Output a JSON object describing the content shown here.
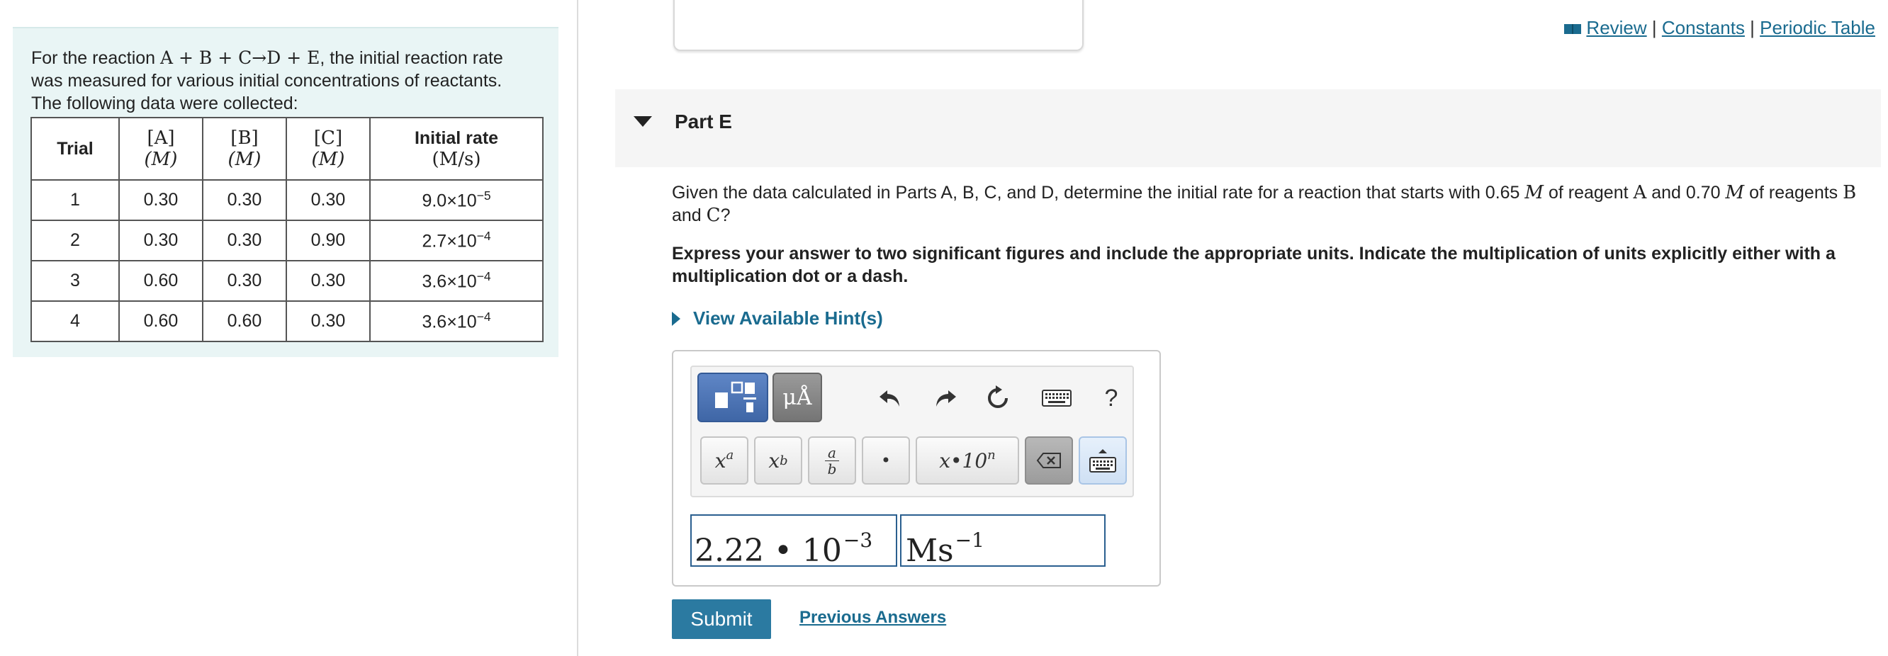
{
  "problem": {
    "intro_prefix": "For the reaction ",
    "reaction": "A + B + C→D + E",
    "intro_line1_suffix": ", the initial reaction rate",
    "intro_line2": "was measured for various initial concentrations of reactants.",
    "intro_line3": "The following data were collected:",
    "table": {
      "headers": {
        "trial": "Trial",
        "a_top": "[A]",
        "a_unit": "(M)",
        "b_top": "[B]",
        "b_unit": "(M)",
        "c_top": "[C]",
        "c_unit": "(M)",
        "rate_top": "Initial rate",
        "rate_unit": "(M/s)"
      },
      "rows": [
        {
          "trial": "1",
          "a": "0.30",
          "b": "0.30",
          "c": "0.30",
          "rate_base": "9.0×10",
          "rate_exp": "−5"
        },
        {
          "trial": "2",
          "a": "0.30",
          "b": "0.30",
          "c": "0.90",
          "rate_base": "2.7×10",
          "rate_exp": "−4"
        },
        {
          "trial": "3",
          "a": "0.60",
          "b": "0.30",
          "c": "0.30",
          "rate_base": "3.6×10",
          "rate_exp": "−4"
        },
        {
          "trial": "4",
          "a": "0.60",
          "b": "0.60",
          "c": "0.30",
          "rate_base": "3.6×10",
          "rate_exp": "−4"
        }
      ]
    }
  },
  "top_links": {
    "review": "Review",
    "sep1": " | ",
    "constants": "Constants",
    "sep2": " | ",
    "periodic_table": "Periodic Table"
  },
  "part": {
    "title": "Part E",
    "q_prefix": "Given the data calculated in Parts A, B, C, and D, determine the initial rate for a reaction that starts with 0.65 ",
    "q_unit1": "M",
    "q_mid1": " of reagent ",
    "q_reagent_a": "A",
    "q_mid2": " and 0.70 ",
    "q_unit2": "M",
    "q_mid3": " of reagents ",
    "q_reagent_b": "B",
    "q_mid4": " and ",
    "q_reagent_c": "C",
    "q_suffix": "?",
    "instructions": "Express your answer to two significant figures and include the appropriate units. Indicate the multiplication of units explicitly either with a multiplication dot or a dash.",
    "hint_label": "View Available Hint(s)"
  },
  "toolbar": {
    "units_label": "μÅ",
    "help_label": "?",
    "sup_base": "x",
    "sup_exp": "a",
    "sub_base": "x",
    "sub_sub": "b",
    "frac_num": "a",
    "frac_den": "b",
    "dot_label": "•",
    "sci_label": "x•10",
    "sci_exp": "n"
  },
  "answer": {
    "value_base": "2.22 • 10",
    "value_exp": "−3",
    "unit_base": "Ms",
    "unit_exp": "−1"
  },
  "actions": {
    "submit_label": "Submit",
    "previous_answers": "Previous Answers"
  },
  "colors": {
    "accent": "#2b7aa1",
    "link": "#1a6b8f",
    "panel_bg": "#e9f5f5"
  }
}
